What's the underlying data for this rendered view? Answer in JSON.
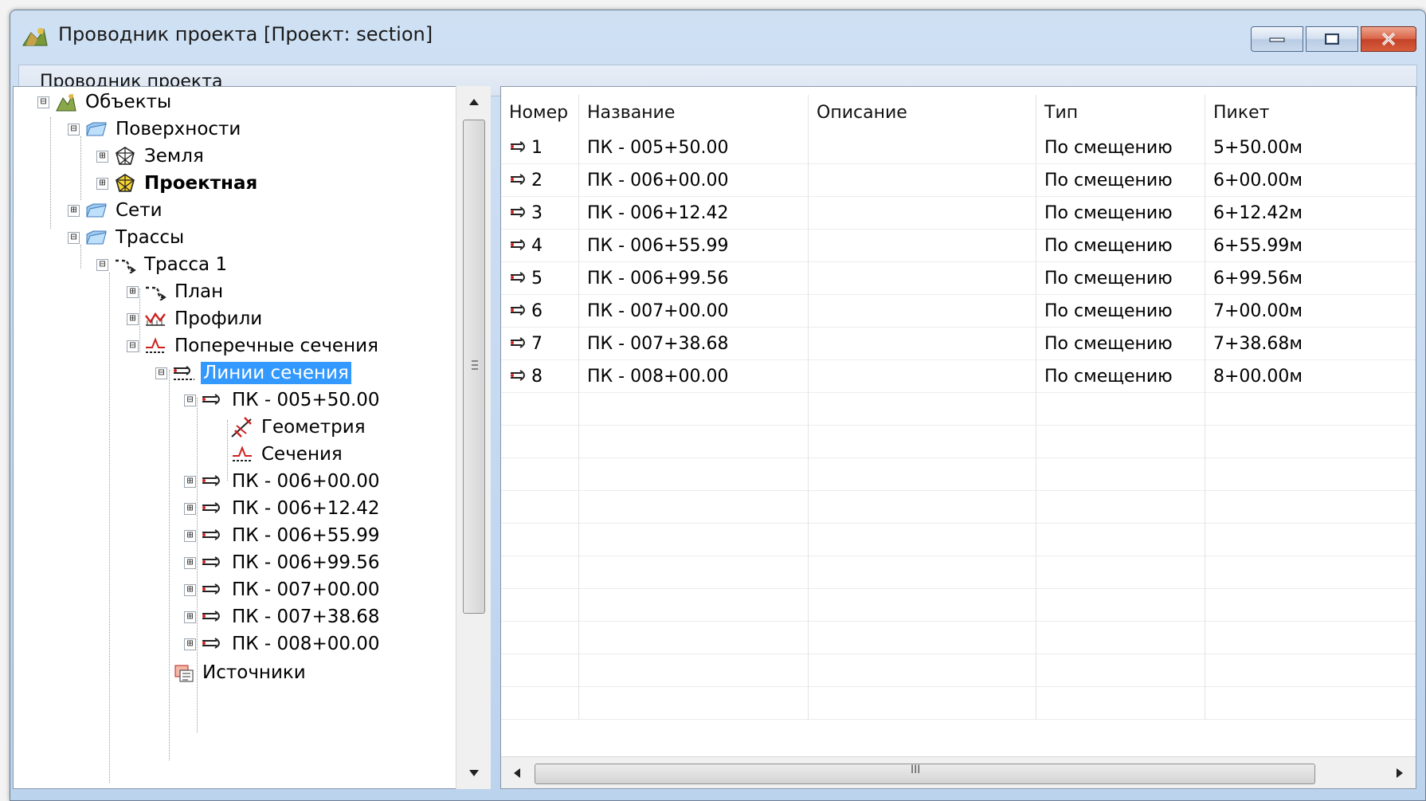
{
  "window": {
    "title": "Проводник проекта [Проект: section]",
    "colors": {
      "selection": "#3399ff",
      "close_button": "#c3422a"
    }
  },
  "menu": {
    "title": "Проводник проекта"
  },
  "tree": {
    "items": [
      {
        "label": "Объекты",
        "icon": "objects-icon",
        "expander": "⊟"
      },
      {
        "label": "Поверхности",
        "icon": "folder-icon",
        "expander": "⊟"
      },
      {
        "label": "Земля",
        "icon": "surface-icon",
        "expander": "⊞"
      },
      {
        "label": "Проектная",
        "icon": "surface-design-icon",
        "expander": "⊞",
        "bold": true
      },
      {
        "label": "Сети",
        "icon": "folder-icon",
        "expander": "⊞"
      },
      {
        "label": "Трассы",
        "icon": "folder-icon",
        "expander": "⊟"
      },
      {
        "label": "Трасса 1",
        "icon": "alignment-icon",
        "expander": "⊟"
      },
      {
        "label": "План",
        "icon": "plan-icon",
        "expander": "⊞"
      },
      {
        "label": "Профили",
        "icon": "profile-icon",
        "expander": "⊞"
      },
      {
        "label": "Поперечные сечения",
        "icon": "cross-section-icon",
        "expander": "⊟"
      },
      {
        "label": "Линии сечения",
        "icon": "section-lines-icon",
        "expander": "⊟",
        "selected": true
      },
      {
        "label": "ПК - 005+50.00",
        "icon": "section-line-icon",
        "expander": "⊟"
      },
      {
        "label": "Геометрия",
        "icon": "geometry-icon"
      },
      {
        "label": "Сечения",
        "icon": "sections-icon"
      },
      {
        "label": "ПК - 006+00.00",
        "icon": "section-line-icon",
        "expander": "⊞"
      },
      {
        "label": "ПК - 006+12.42",
        "icon": "section-line-icon",
        "expander": "⊞"
      },
      {
        "label": "ПК - 006+55.99",
        "icon": "section-line-icon",
        "expander": "⊞"
      },
      {
        "label": "ПК - 006+99.56",
        "icon": "section-line-icon",
        "expander": "⊞"
      },
      {
        "label": "ПК - 007+00.00",
        "icon": "section-line-icon",
        "expander": "⊞"
      },
      {
        "label": "ПК - 007+38.68",
        "icon": "section-line-icon",
        "expander": "⊞"
      },
      {
        "label": "ПК - 008+00.00",
        "icon": "section-line-icon",
        "expander": "⊞"
      },
      {
        "label": "Источники",
        "icon": "sources-icon"
      }
    ]
  },
  "table": {
    "columns": [
      "Номер",
      "Название",
      "Описание",
      "Тип",
      "Пикет"
    ],
    "rows": [
      {
        "num": "1",
        "name": "ПК - 005+50.00",
        "desc": "",
        "type": "По смещению",
        "station": "5+50.00м"
      },
      {
        "num": "2",
        "name": "ПК - 006+00.00",
        "desc": "",
        "type": "По смещению",
        "station": "6+00.00м"
      },
      {
        "num": "3",
        "name": "ПК - 006+12.42",
        "desc": "",
        "type": "По смещению",
        "station": "6+12.42м"
      },
      {
        "num": "4",
        "name": "ПК - 006+55.99",
        "desc": "",
        "type": "По смещению",
        "station": "6+55.99м"
      },
      {
        "num": "5",
        "name": "ПК - 006+99.56",
        "desc": "",
        "type": "По смещению",
        "station": "6+99.56м"
      },
      {
        "num": "6",
        "name": "ПК - 007+00.00",
        "desc": "",
        "type": "По смещению",
        "station": "7+00.00м"
      },
      {
        "num": "7",
        "name": "ПК - 007+38.68",
        "desc": "",
        "type": "По смещению",
        "station": "7+38.68м"
      },
      {
        "num": "8",
        "name": "ПК - 008+00.00",
        "desc": "",
        "type": "По смещению",
        "station": "8+00.00м"
      }
    ]
  },
  "scrollbar": {
    "grip": "III"
  }
}
